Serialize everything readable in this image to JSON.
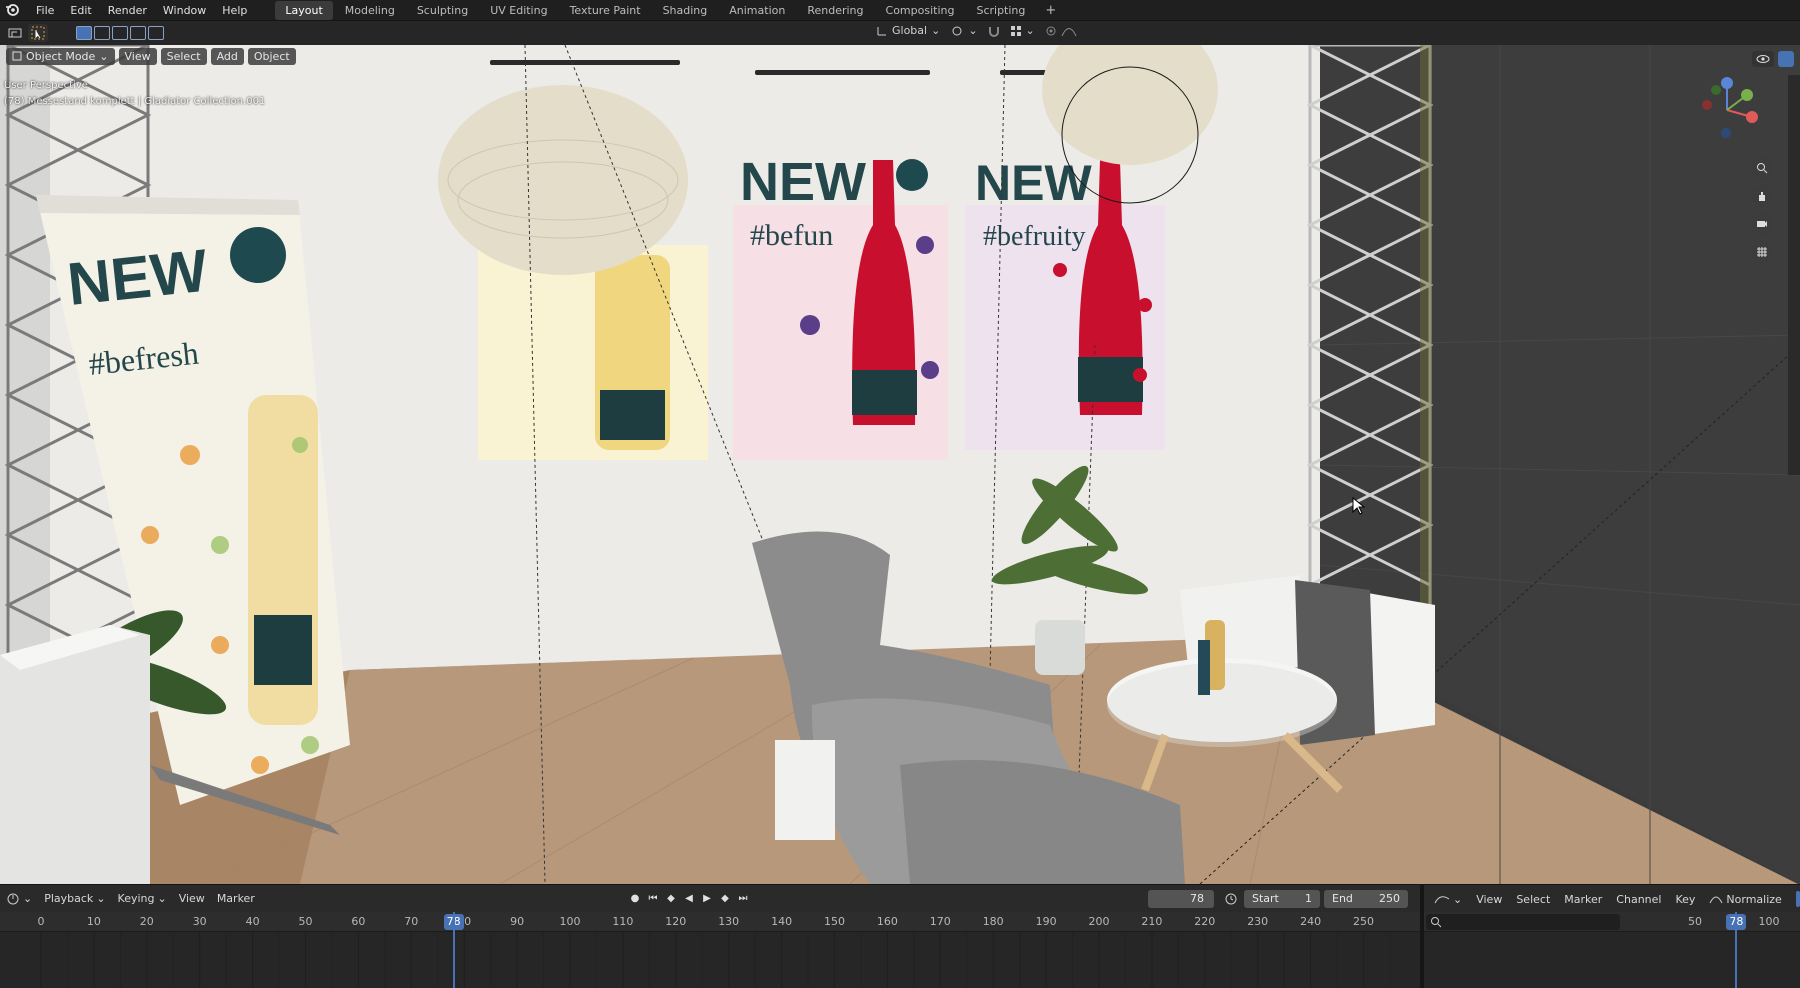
{
  "menu": {
    "file": "File",
    "edit": "Edit",
    "render": "Render",
    "window": "Window",
    "help": "Help"
  },
  "workspaces": [
    "Layout",
    "Modeling",
    "Sculpting",
    "UV Editing",
    "Texture Paint",
    "Shading",
    "Animation",
    "Rendering",
    "Compositing",
    "Scripting"
  ],
  "toolbar": {
    "transform_orientation": "Global"
  },
  "viewport_header": {
    "mode": "Object Mode",
    "view": "View",
    "select": "Select",
    "add": "Add",
    "object": "Object"
  },
  "viewport": {
    "perspective": "User Perspective",
    "collection_info": "(78) Messestand komplett | Gladiator Collection.001"
  },
  "scene_text": {
    "poster1_title": "NEW",
    "poster1_tag": "#befresh",
    "poster2_title": "NEW",
    "poster2_tag": "#befun",
    "poster3_title": "NEW",
    "poster3_tag": "#befruity"
  },
  "timeline": {
    "playback": "Playback",
    "keying": "Keying",
    "view": "View",
    "marker": "Marker",
    "current_frame": "78",
    "start_label": "Start",
    "start": "1",
    "end_label": "End",
    "end": "250",
    "ticks": [
      "0",
      "10",
      "20",
      "30",
      "40",
      "50",
      "60",
      "70",
      "80",
      "90",
      "100",
      "110",
      "120",
      "130",
      "140",
      "150",
      "160",
      "170",
      "180",
      "190",
      "200",
      "210",
      "220",
      "230",
      "240",
      "250"
    ],
    "cursor": "78"
  },
  "graph_editor": {
    "view": "View",
    "select": "Select",
    "marker": "Marker",
    "channel": "Channel",
    "key": "Key",
    "normalize": "Normalize",
    "ticks": [
      "50",
      "100"
    ],
    "cursor": "78"
  },
  "colors": {
    "accent": "#4772b3",
    "bg": "#1d1d1d",
    "wall": "#ecebe8",
    "floor": "#b38f6e"
  }
}
